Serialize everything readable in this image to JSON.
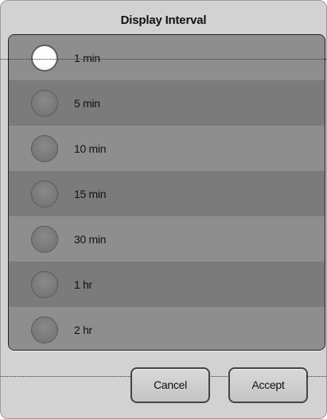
{
  "dialog": {
    "title": "Display Interval",
    "options": [
      {
        "label": "1 min",
        "selected": true
      },
      {
        "label": "5 min",
        "selected": false
      },
      {
        "label": "10 min",
        "selected": false
      },
      {
        "label": "15 min",
        "selected": false
      },
      {
        "label": "30 min",
        "selected": false
      },
      {
        "label": "1 hr",
        "selected": false
      },
      {
        "label": "2 hr",
        "selected": false
      }
    ],
    "buttons": {
      "cancel_label": "Cancel",
      "accept_label": "Accept"
    }
  },
  "colors": {
    "panel_background": "#808080",
    "row_light": "#8e8e8e",
    "row_dark": "#7b7b7b",
    "dialog_background": "#d2d2d2"
  }
}
